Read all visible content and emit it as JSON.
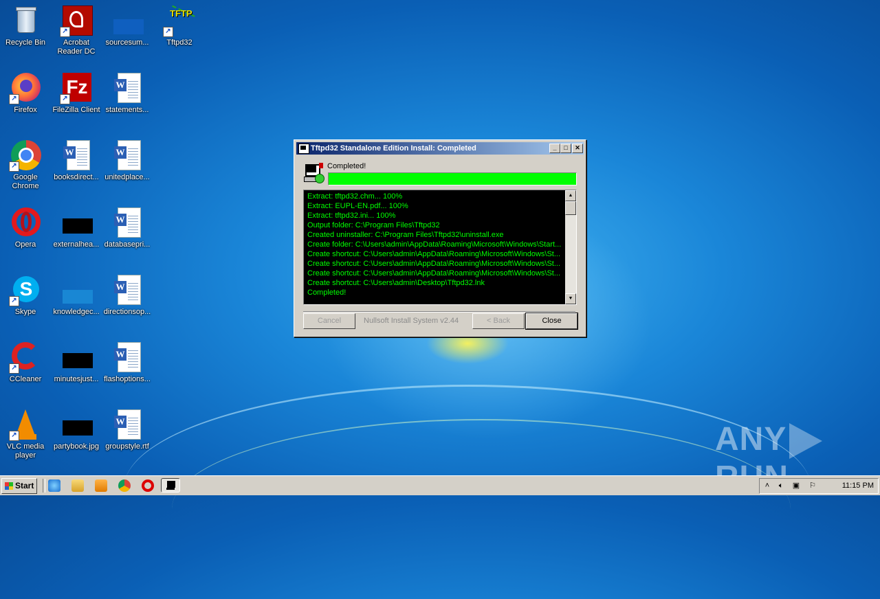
{
  "desktop": {
    "icons": [
      {
        "label": "Recycle Bin"
      },
      {
        "label": "Acrobat Reader DC"
      },
      {
        "label": "sourcesum..."
      },
      {
        "label": "Tftpd32"
      },
      {
        "label": "Firefox"
      },
      {
        "label": "FileZilla Client"
      },
      {
        "label": "statements..."
      },
      {
        "label": "Google Chrome"
      },
      {
        "label": "booksdirect..."
      },
      {
        "label": "unitedplace..."
      },
      {
        "label": "Opera"
      },
      {
        "label": "externalhea..."
      },
      {
        "label": "databasepri..."
      },
      {
        "label": "Skype"
      },
      {
        "label": "knowledgec..."
      },
      {
        "label": "directionsop..."
      },
      {
        "label": "CCleaner"
      },
      {
        "label": "minutesjust..."
      },
      {
        "label": "flashoptions..."
      },
      {
        "label": "VLC media player"
      },
      {
        "label": "partybook.jpg"
      },
      {
        "label": "groupstyle.rtf"
      }
    ]
  },
  "dialog": {
    "title": "Tftpd32 Standalone Edition Install: Completed",
    "status": "Completed!",
    "progress_fraction": 1.0,
    "progress_color": "#00ff00",
    "log_lines": [
      "Extract: tftpd32.chm... 100%",
      "Extract: EUPL-EN.pdf... 100%",
      "Extract: tftpd32.ini... 100%",
      "Output folder: C:\\Program Files\\Tftpd32",
      "Created uninstaller: C:\\Program Files\\Tftpd32\\uninstall.exe",
      "Create folder: C:\\Users\\admin\\AppData\\Roaming\\Microsoft\\Windows\\Start...",
      "Create shortcut: C:\\Users\\admin\\AppData\\Roaming\\Microsoft\\Windows\\St...",
      "Create shortcut: C:\\Users\\admin\\AppData\\Roaming\\Microsoft\\Windows\\St...",
      "Create shortcut: C:\\Users\\admin\\AppData\\Roaming\\Microsoft\\Windows\\St...",
      "Create shortcut: C:\\Users\\admin\\Desktop\\Tftpd32.lnk",
      "Completed!"
    ],
    "buttons": {
      "cancel": "Cancel",
      "back": "< Back",
      "close": "Close"
    },
    "branding": "Nullsoft Install System v2.44",
    "window_buttons": {
      "minimize": "_",
      "maximize": "□",
      "close": "✕"
    }
  },
  "taskbar": {
    "start_label": "Start",
    "clock": "11:15 PM",
    "quicklaunch": [
      "internet-explorer-icon",
      "explorer-icon",
      "media-player-icon",
      "chrome-icon",
      "opera-icon",
      "installer-task-icon"
    ]
  },
  "watermark": {
    "left": "ANY",
    "right": "RUN"
  }
}
